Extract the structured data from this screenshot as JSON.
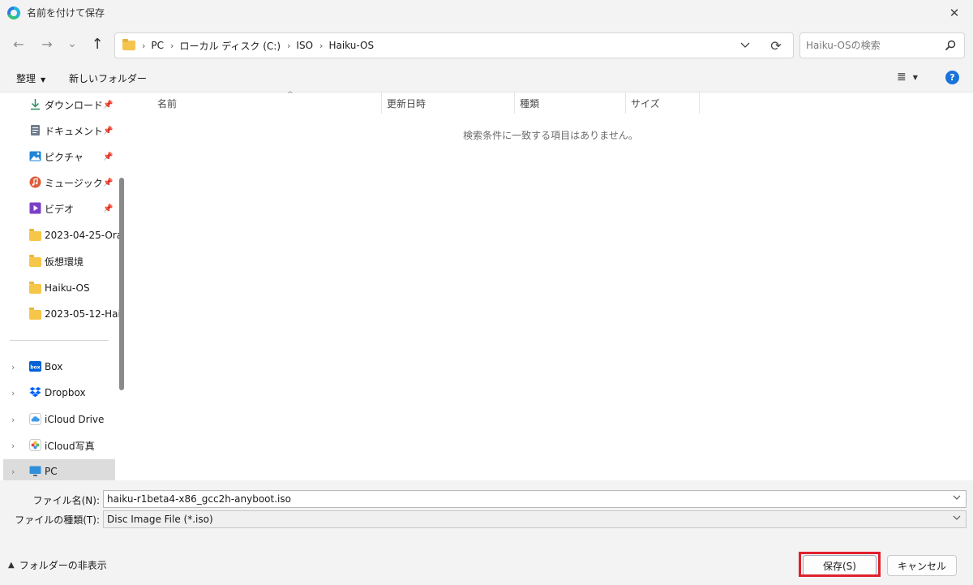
{
  "window": {
    "title": "名前を付けて保存",
    "close_glyph": "✕"
  },
  "nav": {
    "back_glyph": "←",
    "forward_glyph": "→",
    "recent_glyph": "⌄",
    "up_glyph": "↑",
    "breadcrumbs": [
      "PC",
      "ローカル ディスク (C:)",
      "ISO",
      "Haiku-OS"
    ],
    "crumb_separator": "›",
    "refresh_glyph": "⟳",
    "search_placeholder": "Haiku-OSの検索"
  },
  "toolbar": {
    "organize_label": "整理",
    "new_folder_label": "新しいフォルダー",
    "help_glyph": "?"
  },
  "sidebar": {
    "quick_access": [
      {
        "label": "ダウンロード",
        "icon": "download-icon",
        "pinned": true
      },
      {
        "label": "ドキュメント",
        "icon": "document-icon",
        "pinned": true
      },
      {
        "label": "ピクチャ",
        "icon": "pictures-icon",
        "pinned": true
      },
      {
        "label": "ミュージック",
        "icon": "music-icon",
        "pinned": true
      },
      {
        "label": "ビデオ",
        "icon": "video-icon",
        "pinned": true
      },
      {
        "label": "2023-04-25-Ora",
        "icon": "folder-icon",
        "pinned": false
      },
      {
        "label": "仮想環境",
        "icon": "folder-icon",
        "pinned": false
      },
      {
        "label": "Haiku-OS",
        "icon": "folder-icon",
        "pinned": false
      },
      {
        "label": "2023-05-12-Hai",
        "icon": "folder-icon",
        "pinned": false
      }
    ],
    "locations": [
      {
        "label": "Box",
        "icon": "box-icon"
      },
      {
        "label": "Dropbox",
        "icon": "dropbox-icon"
      },
      {
        "label": "iCloud Drive",
        "icon": "icloud-drive-icon"
      },
      {
        "label": "iCloud写真",
        "icon": "icloud-photos-icon"
      },
      {
        "label": "PC",
        "icon": "pc-icon",
        "selected": true
      }
    ]
  },
  "file_list": {
    "columns": [
      "名前",
      "更新日時",
      "種類",
      "サイズ"
    ],
    "sort_indicator": "^",
    "empty_message": "検索条件に一致する項目はありません。"
  },
  "form": {
    "filename_label": "ファイル名(N):",
    "filename_value": "haiku-r1beta4-x86_gcc2h-anyboot.iso",
    "filetype_label": "ファイルの種類(T):",
    "filetype_value": "Disc Image File (*.iso)",
    "hide_folders_label": "フォルダーの非表示",
    "save_label": "保存(S)",
    "cancel_label": "キャンセル"
  },
  "colors": {
    "accent": "#1a73d9",
    "highlight_box": "#e0202b",
    "folder": "#f6c648"
  }
}
